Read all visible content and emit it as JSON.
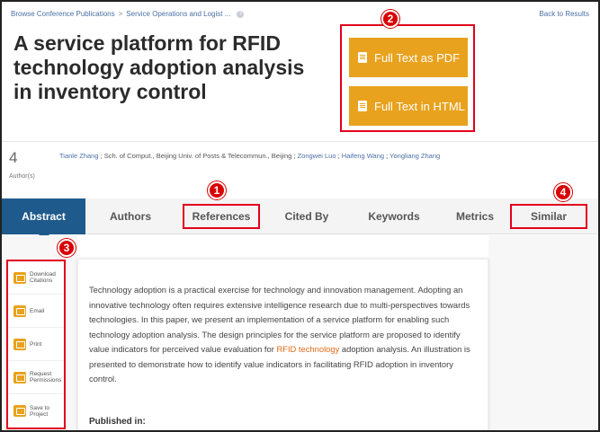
{
  "breadcrumb": {
    "items": [
      "Browse Conference Publications",
      "Service Operations and Logist ..."
    ],
    "separator": ">",
    "help_glyph": "?"
  },
  "back_link": "Back to Results",
  "title": "A service platform for RFID technology adoption analysis in inventory control",
  "full_text": {
    "pdf_label": "Full Text as PDF",
    "html_label": "Full Text in HTML"
  },
  "callouts": [
    "1",
    "2",
    "3",
    "4"
  ],
  "authors": {
    "count": "4",
    "count_label": "Author(s)",
    "list": [
      {
        "name": "Tianle Zhang",
        "affil": " ; Sch. of Comput., Beijing Univ. of Posts & Telecommun., Beijing ; "
      },
      {
        "name": "Zongwei Luo",
        "affil": " ; "
      },
      {
        "name": "Haifeng Wang",
        "affil": " ; "
      },
      {
        "name": "Yongliang Zhang",
        "affil": ""
      }
    ]
  },
  "tabs": [
    "Abstract",
    "Authors",
    "References",
    "Cited By",
    "Keywords",
    "Metrics",
    "Similar"
  ],
  "tools": [
    {
      "label": "Download Citations",
      "icon": "download-icon"
    },
    {
      "label": "Email",
      "icon": "email-icon"
    },
    {
      "label": "Print",
      "icon": "print-icon"
    },
    {
      "label": "Request Permissions",
      "icon": "permissions-icon"
    },
    {
      "label": "Save to Project",
      "icon": "save-icon"
    }
  ],
  "abstract": {
    "before_link": "Technology adoption is a practical exercise for technology and innovation management. Adopting an innovative technology often requires extensive intelligence research due to multi-perspectives towards technologies. In this paper, we present an implementation of a service platform for enabling such technology adoption analysis. The design principles for the service platform are proposed to identify value indicators for perceived value evaluation for ",
    "link": "RFID technology",
    "after_link": " adoption analysis. An illustration is presented to demonstrate how to identify value indicators in facilitating RFID adoption in inventory control.",
    "published_label": "Published in:"
  },
  "colors": {
    "accent_orange": "#e8a21e",
    "tab_active": "#1f5a8c",
    "highlight_red": "#e2001a",
    "link_blue": "#4a6fa5"
  }
}
